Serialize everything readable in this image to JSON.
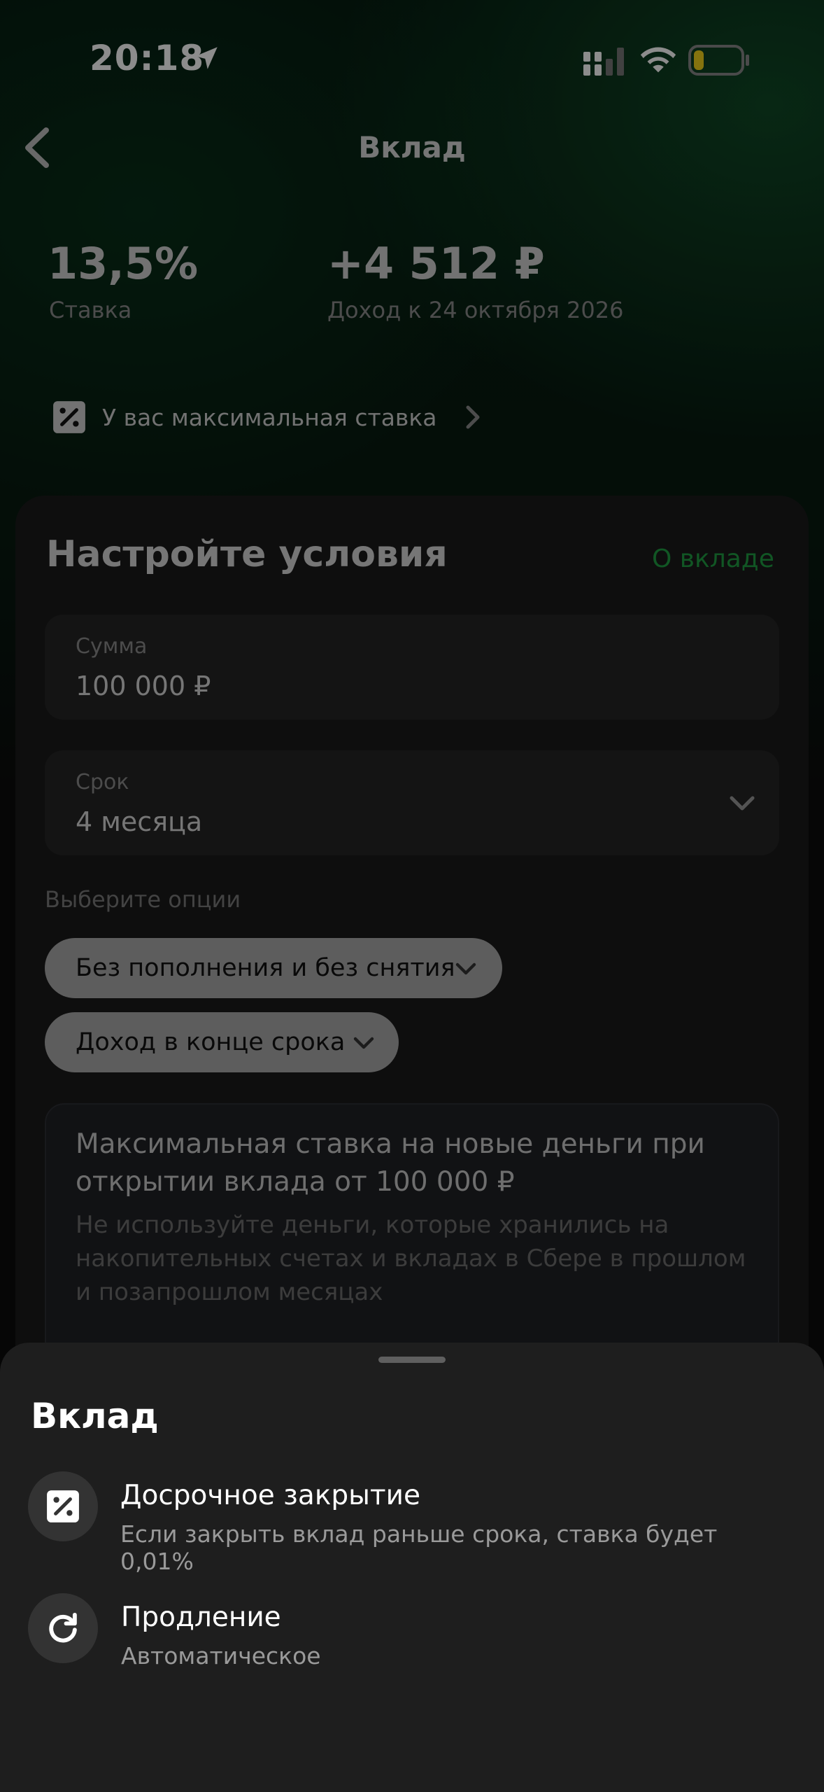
{
  "status_bar": {
    "time": "20:18"
  },
  "header": {
    "title": "Вклад"
  },
  "summary": {
    "rate_value": "13,5%",
    "rate_label": "Ставка",
    "income_value": "+4 512 ₽",
    "income_label": "Доход к 24 октября 2026"
  },
  "max_rate_link": {
    "text": "У вас максимальная ставка"
  },
  "conditions": {
    "title": "Настройте условия",
    "about_link": "О вкладе",
    "amount": {
      "label": "Сумма",
      "value": "100 000 ₽"
    },
    "term": {
      "label": "Срок",
      "value": "4 месяца"
    },
    "options_label": "Выберите опции",
    "options": [
      {
        "label": "Без пополнения и без снятия"
      },
      {
        "label": "Доход в конце срока"
      }
    ],
    "info": {
      "title": "Максимальная ставка на новые деньги при открытии вклада от 100 000 ₽",
      "text": "Не используйте деньги, которые хранились на накопительных счетах и вкладах в Сбере в прошлом и позапрошлом месяцах"
    }
  },
  "sheet": {
    "title": "Вклад",
    "items": [
      {
        "title": "Досрочное закрытие",
        "subtitle": "Если закрыть вклад раньше срока, ставка будет 0,01%",
        "icon": "percent-icon"
      },
      {
        "title": "Продление",
        "subtitle": "Автоматическое",
        "icon": "refresh-icon"
      }
    ]
  },
  "colors": {
    "accent": "#1f9d43",
    "battery_low": "#f2d11a"
  }
}
